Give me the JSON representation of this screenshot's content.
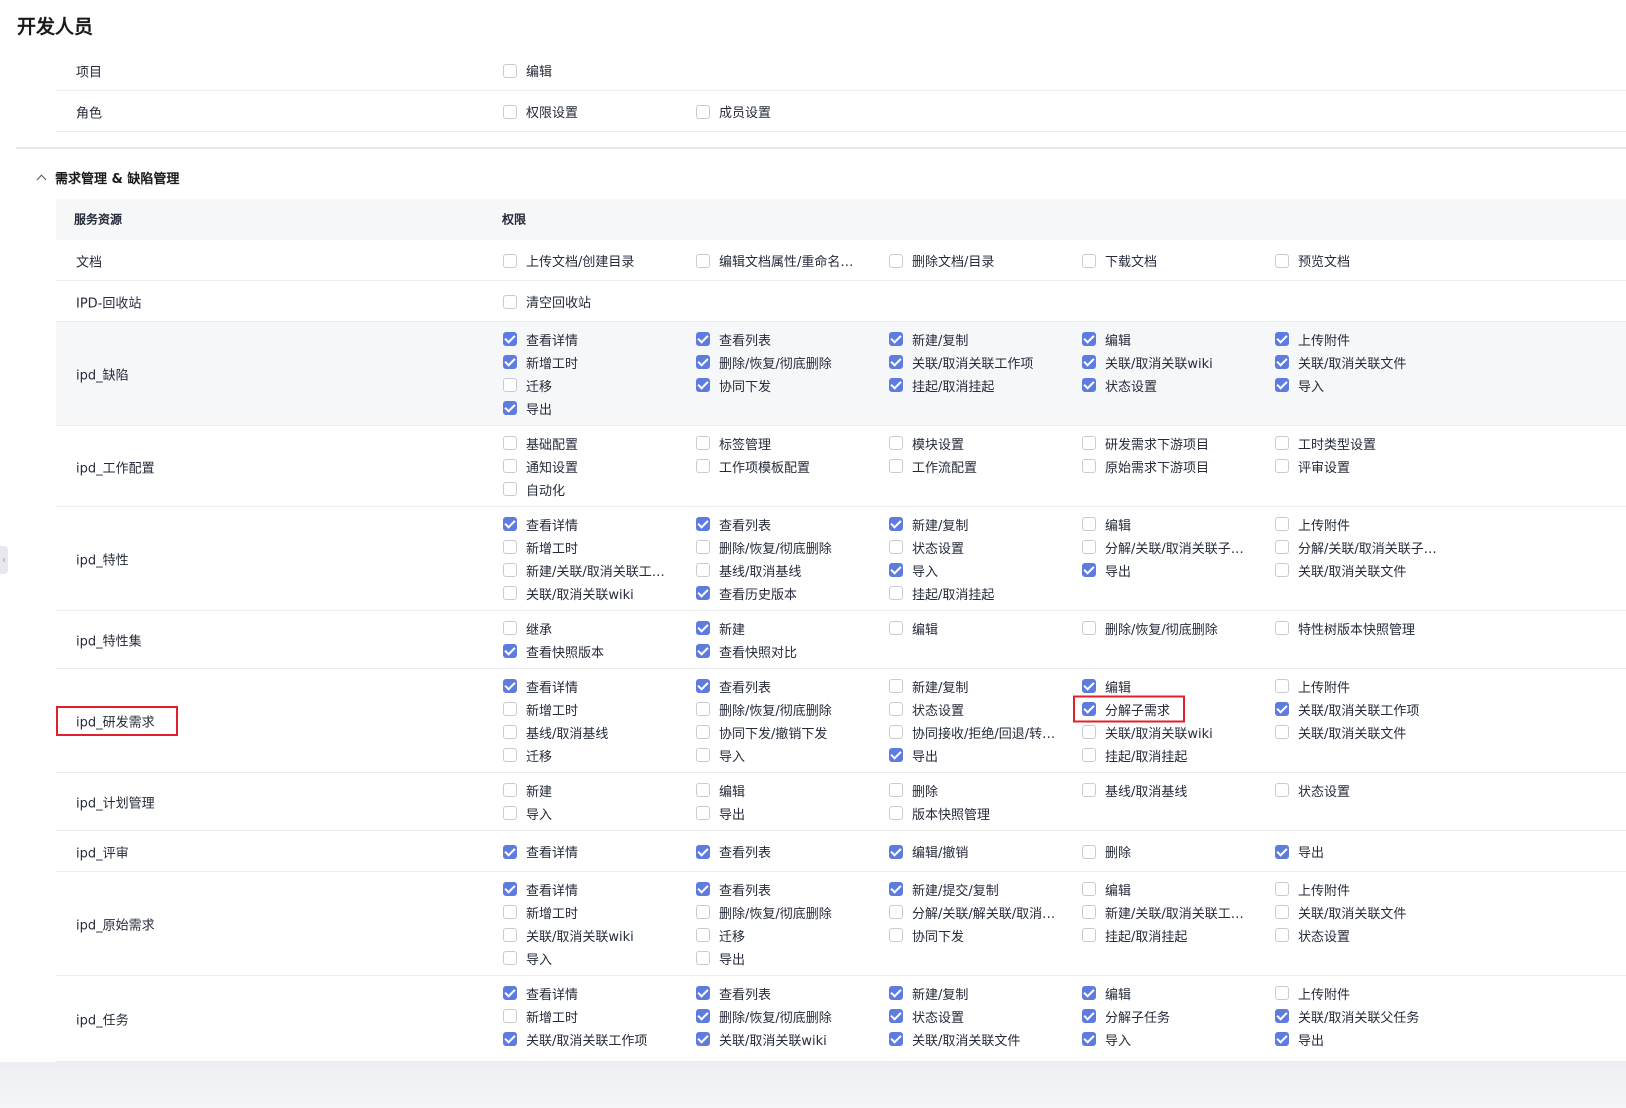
{
  "page": {
    "title": "开发人员"
  },
  "top_rows": [
    {
      "name": "项目",
      "perms": [
        {
          "label": "编辑",
          "checked": false
        }
      ]
    },
    {
      "name": "角色",
      "perms": [
        {
          "label": "权限设置",
          "checked": false
        },
        {
          "label": "成员设置",
          "checked": false
        }
      ]
    }
  ],
  "section": {
    "title": "需求管理 & 缺陷管理",
    "expand_icon": "chevron-up-icon",
    "header": {
      "resource": "服务资源",
      "permission": "权限"
    },
    "colors": {
      "checked": "#5e7ce0",
      "highlight": "#e0202b"
    },
    "rows": [
      {
        "name": "文档",
        "perms": [
          {
            "label": "上传文档/创建目录",
            "checked": false
          },
          {
            "label": "编辑文档属性/重命名…",
            "checked": false
          },
          {
            "label": "删除文档/目录",
            "checked": false
          },
          {
            "label": "下载文档",
            "checked": false
          },
          {
            "label": "预览文档",
            "checked": false
          }
        ]
      },
      {
        "name": "IPD-回收站",
        "perms": [
          {
            "label": "清空回收站",
            "checked": false
          }
        ]
      },
      {
        "name": "ipd_缺陷",
        "shaded": true,
        "perms": [
          {
            "label": "查看详情",
            "checked": true
          },
          {
            "label": "查看列表",
            "checked": true
          },
          {
            "label": "新建/复制",
            "checked": true
          },
          {
            "label": "编辑",
            "checked": true
          },
          {
            "label": "上传附件",
            "checked": true
          },
          {
            "label": "新增工时",
            "checked": true
          },
          {
            "label": "删除/恢复/彻底删除",
            "checked": true
          },
          {
            "label": "关联/取消关联工作项",
            "checked": true
          },
          {
            "label": "关联/取消关联wiki",
            "checked": true
          },
          {
            "label": "关联/取消关联文件",
            "checked": true
          },
          {
            "label": "迁移",
            "checked": false
          },
          {
            "label": "协同下发",
            "checked": true
          },
          {
            "label": "挂起/取消挂起",
            "checked": true
          },
          {
            "label": "状态设置",
            "checked": true
          },
          {
            "label": "导入",
            "checked": true
          },
          {
            "label": "导出",
            "checked": true
          }
        ]
      },
      {
        "name": "ipd_工作配置",
        "perms": [
          {
            "label": "基础配置",
            "checked": false
          },
          {
            "label": "标签管理",
            "checked": false
          },
          {
            "label": "模块设置",
            "checked": false
          },
          {
            "label": "研发需求下游项目",
            "checked": false
          },
          {
            "label": "工时类型设置",
            "checked": false
          },
          {
            "label": "通知设置",
            "checked": false
          },
          {
            "label": "工作项模板配置",
            "checked": false
          },
          {
            "label": "工作流配置",
            "checked": false
          },
          {
            "label": "原始需求下游项目",
            "checked": false
          },
          {
            "label": "评审设置",
            "checked": false
          },
          {
            "label": "自动化",
            "checked": false
          }
        ]
      },
      {
        "name": "ipd_特性",
        "perms": [
          {
            "label": "查看详情",
            "checked": true
          },
          {
            "label": "查看列表",
            "checked": true
          },
          {
            "label": "新建/复制",
            "checked": true
          },
          {
            "label": "编辑",
            "checked": false
          },
          {
            "label": "上传附件",
            "checked": false
          },
          {
            "label": "新增工时",
            "checked": false
          },
          {
            "label": "删除/恢复/彻底删除",
            "checked": false
          },
          {
            "label": "状态设置",
            "checked": false
          },
          {
            "label": "分解/关联/取消关联子…",
            "checked": false
          },
          {
            "label": "分解/关联/取消关联子…",
            "checked": false
          },
          {
            "label": "新建/关联/取消关联工…",
            "checked": false
          },
          {
            "label": "基线/取消基线",
            "checked": false
          },
          {
            "label": "导入",
            "checked": true
          },
          {
            "label": "导出",
            "checked": true
          },
          {
            "label": "关联/取消关联文件",
            "checked": false
          },
          {
            "label": "关联/取消关联wiki",
            "checked": false
          },
          {
            "label": "查看历史版本",
            "checked": true
          },
          {
            "label": "挂起/取消挂起",
            "checked": false
          }
        ]
      },
      {
        "name": "ipd_特性集",
        "perms": [
          {
            "label": "继承",
            "checked": false
          },
          {
            "label": "新建",
            "checked": true
          },
          {
            "label": "编辑",
            "checked": false
          },
          {
            "label": "删除/恢复/彻底删除",
            "checked": false
          },
          {
            "label": "特性树版本快照管理",
            "checked": false
          },
          {
            "label": "查看快照版本",
            "checked": true
          },
          {
            "label": "查看快照对比",
            "checked": true
          }
        ]
      },
      {
        "name": "ipd_研发需求",
        "highlighted": true,
        "perms": [
          {
            "label": "查看详情",
            "checked": true
          },
          {
            "label": "查看列表",
            "checked": true
          },
          {
            "label": "新建/复制",
            "checked": false
          },
          {
            "label": "编辑",
            "checked": true
          },
          {
            "label": "上传附件",
            "checked": false
          },
          {
            "label": "新增工时",
            "checked": false
          },
          {
            "label": "删除/恢复/彻底删除",
            "checked": false
          },
          {
            "label": "状态设置",
            "checked": false
          },
          {
            "label": "分解子需求",
            "checked": true,
            "highlighted": true
          },
          {
            "label": "关联/取消关联工作项",
            "checked": true
          },
          {
            "label": "基线/取消基线",
            "checked": false
          },
          {
            "label": "协同下发/撤销下发",
            "checked": false
          },
          {
            "label": "协同接收/拒绝/回退/转…",
            "checked": false
          },
          {
            "label": "关联/取消关联wiki",
            "checked": false
          },
          {
            "label": "关联/取消关联文件",
            "checked": false
          },
          {
            "label": "迁移",
            "checked": false
          },
          {
            "label": "导入",
            "checked": false
          },
          {
            "label": "导出",
            "checked": true
          },
          {
            "label": "挂起/取消挂起",
            "checked": false
          }
        ]
      },
      {
        "name": "ipd_计划管理",
        "perms": [
          {
            "label": "新建",
            "checked": false
          },
          {
            "label": "编辑",
            "checked": false
          },
          {
            "label": "删除",
            "checked": false
          },
          {
            "label": "基线/取消基线",
            "checked": false
          },
          {
            "label": "状态设置",
            "checked": false
          },
          {
            "label": "导入",
            "checked": false
          },
          {
            "label": "导出",
            "checked": false
          },
          {
            "label": "版本快照管理",
            "checked": false
          }
        ]
      },
      {
        "name": "ipd_评审",
        "perms": [
          {
            "label": "查看详情",
            "checked": true
          },
          {
            "label": "查看列表",
            "checked": true
          },
          {
            "label": "编辑/撤销",
            "checked": true
          },
          {
            "label": "删除",
            "checked": false
          },
          {
            "label": "导出",
            "checked": true
          }
        ]
      },
      {
        "name": "ipd_原始需求",
        "perms": [
          {
            "label": "查看详情",
            "checked": true
          },
          {
            "label": "查看列表",
            "checked": true
          },
          {
            "label": "新建/提交/复制",
            "checked": true
          },
          {
            "label": "编辑",
            "checked": false
          },
          {
            "label": "上传附件",
            "checked": false
          },
          {
            "label": "新增工时",
            "checked": false
          },
          {
            "label": "删除/恢复/彻底删除",
            "checked": false
          },
          {
            "label": "分解/关联/解关联/取消…",
            "checked": false
          },
          {
            "label": "新建/关联/取消关联工…",
            "checked": false
          },
          {
            "label": "关联/取消关联文件",
            "checked": false
          },
          {
            "label": "关联/取消关联wiki",
            "checked": false
          },
          {
            "label": "迁移",
            "checked": false
          },
          {
            "label": "协同下发",
            "checked": false
          },
          {
            "label": "挂起/取消挂起",
            "checked": false
          },
          {
            "label": "状态设置",
            "checked": false
          },
          {
            "label": "导入",
            "checked": false
          },
          {
            "label": "导出",
            "checked": false
          }
        ]
      },
      {
        "name": "ipd_任务",
        "perms": [
          {
            "label": "查看详情",
            "checked": true
          },
          {
            "label": "查看列表",
            "checked": true
          },
          {
            "label": "新建/复制",
            "checked": true
          },
          {
            "label": "编辑",
            "checked": true
          },
          {
            "label": "上传附件",
            "checked": false
          },
          {
            "label": "新增工时",
            "checked": false
          },
          {
            "label": "删除/恢复/彻底删除",
            "checked": true
          },
          {
            "label": "状态设置",
            "checked": true
          },
          {
            "label": "分解子任务",
            "checked": true
          },
          {
            "label": "关联/取消关联父任务",
            "checked": true
          },
          {
            "label": "关联/取消关联工作项",
            "checked": true
          },
          {
            "label": "关联/取消关联wiki",
            "checked": true
          },
          {
            "label": "关联/取消关联文件",
            "checked": true
          },
          {
            "label": "导入",
            "checked": true
          },
          {
            "label": "导出",
            "checked": true
          }
        ]
      }
    ]
  }
}
